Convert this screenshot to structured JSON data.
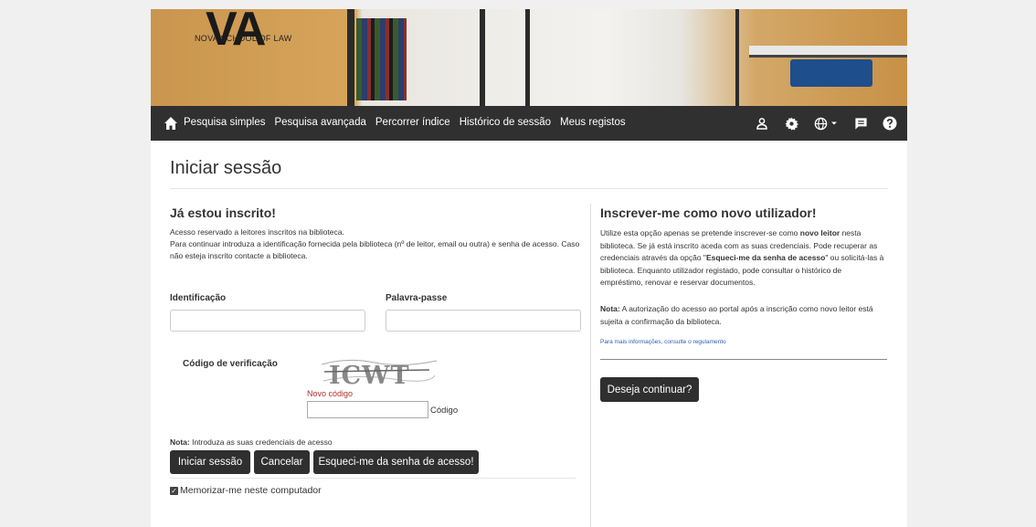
{
  "banner": {
    "logo_mark": "VA",
    "logo_text": "NOVA SCHOOL OF LAW"
  },
  "nav": {
    "links": [
      "Pesquisa simples",
      "Pesquisa avançada",
      "Percorrer índice",
      "Histórico de sessão",
      "Meus registos"
    ],
    "icons": [
      "home-icon",
      "user-icon",
      "gear-icon",
      "globe-icon",
      "chevron-down-icon",
      "message-icon",
      "help-icon"
    ]
  },
  "page_title": "Iniciar sessão",
  "left": {
    "heading": "Já estou inscrito!",
    "desc_1": "Acesso reservado a leitores inscritos na biblioteca.",
    "desc_2": "Para continuar introduza a identificação fornecida pela biblioteca (nº de leitor, email ou outra) e senha de acesso. Caso não esteja inscrito contacte a biblioteca.",
    "id_label": "Identificação",
    "id_value": "",
    "pw_label": "Palavra-passe",
    "pw_value": "",
    "captcha_label": "Código de verificação",
    "captcha_text": "ICWT",
    "novo_codigo": "Novo código",
    "code_value": "",
    "code_label": "Código",
    "nota_bold": "Nota:",
    "nota_text": " Introduza as suas credenciais de acesso",
    "btn_login": "Iniciar sessão",
    "btn_cancel": "Cancelar",
    "btn_forgot": "Esqueci-me da senha de acesso!",
    "remember": "Memorizar-me neste computador",
    "remember_checked": true
  },
  "right": {
    "heading": "Inscrever-me como novo utilizador!",
    "p_a": "Utilize esta opção apenas se pretende inscrever-se como ",
    "p_b": "novo leitor",
    "p_c": " nesta biblioteca. Se já está inscrito aceda com as suas credenciais. Pode recuperar as credenciais através da opção \"",
    "p_d": "Esqueci-me da senha de acesso",
    "p_e": "\" ou solicitá-las à biblioteca. Enquanto utilizador registado, pode consultar o histórico de empréstimo, renovar e reservar documentos.",
    "nota_bold": "Nota:",
    "nota_text": " A autorização do acesso ao portal após a inscrição como novo leitor está sujeita a confirmação da biblioteca.",
    "link": "Para mais informações, consulte o regulamento",
    "btn_continue": "Deseja continuar?"
  },
  "colors": {
    "navbar": "#303030",
    "button": "#2f2f2f",
    "link": "#2a5db0",
    "novo_codigo": "#b03030"
  }
}
